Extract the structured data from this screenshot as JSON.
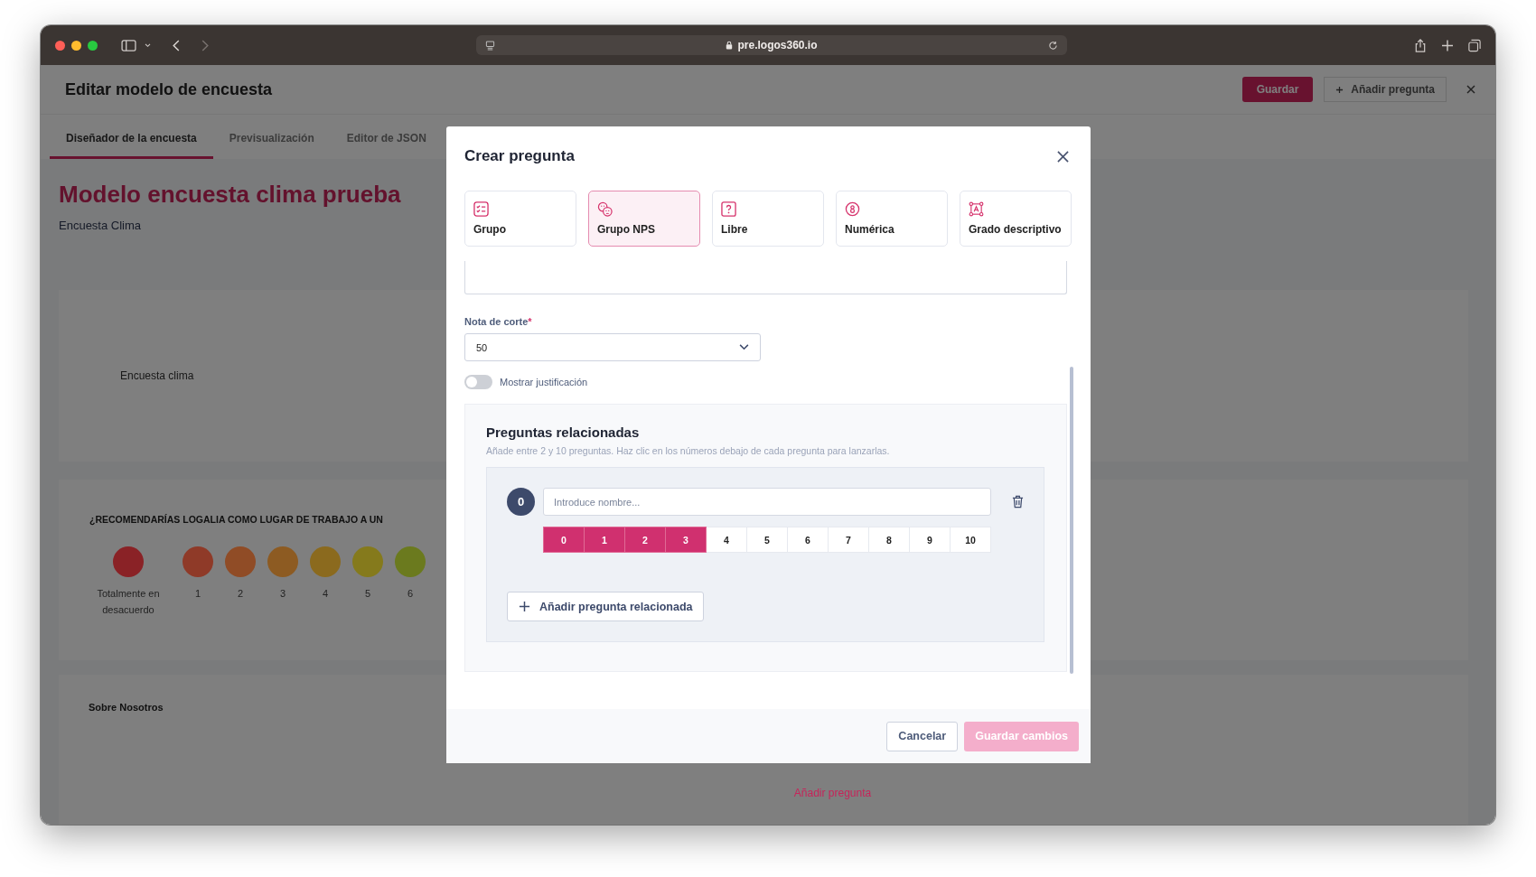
{
  "browser": {
    "url": "pre.logos360.io"
  },
  "page": {
    "title": "Editar modelo de encuesta",
    "save_button": "Guardar",
    "add_question_button": "Añadir pregunta",
    "tabs": [
      {
        "label": "Diseñador de la encuesta",
        "selected": true
      },
      {
        "label": "Previsualización",
        "selected": false
      },
      {
        "label": "Editor de JSON",
        "selected": false
      }
    ],
    "survey_title": "Modelo encuesta clima prueba",
    "survey_subtitle": "Encuesta Clima",
    "intro_card": {
      "text": "Encuesta clima"
    },
    "question_card": {
      "question": "¿RECOMENDARÍAS LOGALIA COMO LUGAR DE TRABAJO A UN",
      "scale": [
        {
          "label": "Totalmente en desacuerdo",
          "color": "#8a2226"
        },
        {
          "label": "1",
          "color": "#8f3a28"
        },
        {
          "label": "2",
          "color": "#904c26"
        },
        {
          "label": "3",
          "color": "#8d5b22"
        },
        {
          "label": "4",
          "color": "#8b6a1e"
        },
        {
          "label": "5",
          "color": "#857a1c"
        },
        {
          "label": "6",
          "color": "#6b7a1e"
        }
      ]
    },
    "section_card": {
      "title": "Sobre Nosotros",
      "add_link": "Añadir pregunta"
    }
  },
  "dialog": {
    "title": "Crear pregunta",
    "types": [
      {
        "label": "Grupo",
        "kind": "group",
        "selected": false
      },
      {
        "label": "Grupo NPS",
        "kind": "nps",
        "selected": true
      },
      {
        "label": "Libre",
        "kind": "free",
        "selected": false
      },
      {
        "label": "Numérica",
        "kind": "numeric",
        "selected": false
      },
      {
        "label": "Grado descriptivo",
        "kind": "descriptive",
        "selected": false
      }
    ],
    "cutoff": {
      "label": "Nota de corte",
      "required_mark": "*",
      "value": "50"
    },
    "justification_toggle": {
      "label": "Mostrar justificación",
      "on": false
    },
    "related": {
      "title": "Preguntas relacionadas",
      "hint": "Añade entre 2 y 10 preguntas. Haz clic en los números debajo de cada pregunta para lanzarlas.",
      "items": [
        {
          "index": "0",
          "placeholder": "Introduce nombre...",
          "scale": [
            {
              "label": "0",
              "selected": true
            },
            {
              "label": "1",
              "selected": true
            },
            {
              "label": "2",
              "selected": true
            },
            {
              "label": "3",
              "selected": true
            },
            {
              "label": "4",
              "selected": false
            },
            {
              "label": "5",
              "selected": false
            },
            {
              "label": "6",
              "selected": false
            },
            {
              "label": "7",
              "selected": false
            },
            {
              "label": "8",
              "selected": false
            },
            {
              "label": "9",
              "selected": false
            },
            {
              "label": "10",
              "selected": false
            }
          ]
        }
      ],
      "add_button": "Añadir pregunta relacionada"
    },
    "buttons": {
      "cancel": "Cancelar",
      "save": {
        "label": "Guardar cambios",
        "disabled": true
      }
    }
  }
}
